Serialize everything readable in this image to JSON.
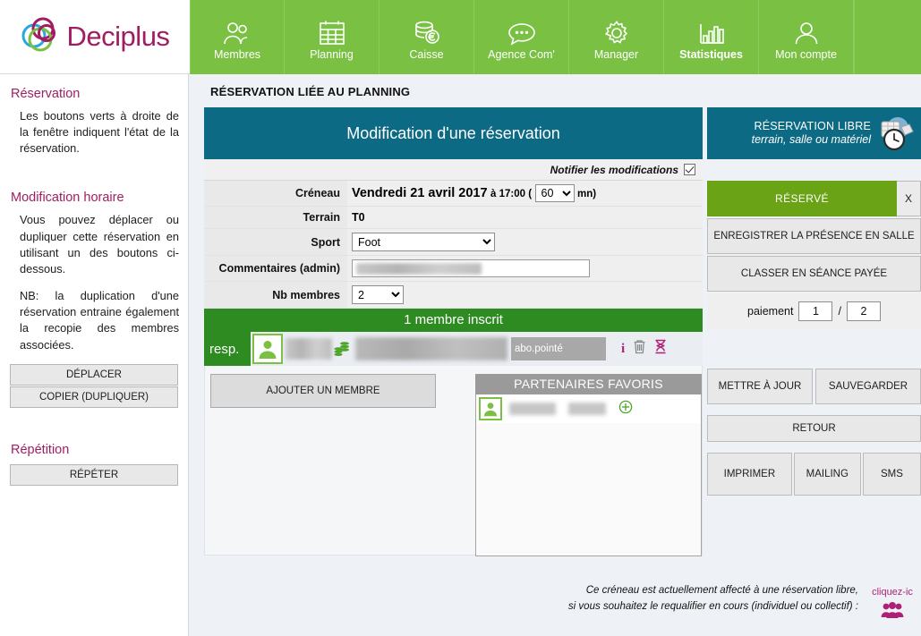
{
  "brand": {
    "name": "Deciplus",
    "logo_icon": "deciplus-rings-logo",
    "colors": {
      "magenta": "#a01d62",
      "green": "#7ac143",
      "teal": "#0d6a84",
      "blue": "#29a8df"
    }
  },
  "nav": {
    "items": [
      {
        "label": "Membres",
        "icon": "members-icon",
        "active": false
      },
      {
        "label": "Planning",
        "icon": "calendar-icon",
        "active": false
      },
      {
        "label": "Caisse",
        "icon": "cash-euro-icon",
        "active": false
      },
      {
        "label": "Agence Com'",
        "icon": "chat-bubble-icon",
        "active": false
      },
      {
        "label": "Manager",
        "icon": "gear-icon",
        "active": false
      },
      {
        "label": "Statistiques",
        "icon": "bar-chart-icon",
        "active": true
      },
      {
        "label": "Mon compte",
        "icon": "user-icon",
        "active": false
      }
    ]
  },
  "sidebar": {
    "section1_title": "Réservation",
    "section1_text": "Les boutons verts à droite de la fenêtre indiquent l'état de la réservation.",
    "section2_title": "Modification horaire",
    "section2_text": "Vous pouvez déplacer ou dupliquer cette réservation en utilisant un des boutons ci-dessous.",
    "section2_note": "NB: la duplication d'une réservation entraine également la recopie des membres associées.",
    "btn_deplacer": "DÉPLACER",
    "btn_copier": "COPIER (DUPLIQUER)",
    "section3_title": "Répétition",
    "btn_repeter": "RÉPÉTER"
  },
  "main": {
    "page_title": "RÉSERVATION LIÉE AU PLANNING",
    "panel_title": "Modification d'une réservation",
    "free_res": {
      "line1": "RÉSERVATION LIBRE",
      "line2": "terrain, salle ou matériel",
      "icon": "calendar-clock-icon"
    },
    "notify_label": "Notifier les modifications",
    "notify_checked": true,
    "form": {
      "creneau_label": "Créneau",
      "creneau_date": "Vendredi 21 avril 2017",
      "creneau_at": "à 17:00 (",
      "creneau_duration": "60",
      "creneau_unit": "mn)",
      "terrain_label": "Terrain",
      "terrain_value": "T0",
      "sport_label": "Sport",
      "sport_value": "Foot",
      "comments_label": "Commentaires (admin)",
      "comments_value": "",
      "nb_label": "Nb membres",
      "nb_value": "2"
    },
    "members": {
      "header": "1 membre inscrit",
      "resp_label": "resp.",
      "row": {
        "avatar_icon": "person-avatar-icon",
        "name": "",
        "coins_icon": "coins-icon",
        "status": "abo.pointé",
        "info_icon": "info-icon",
        "delete_icon": "trash-icon",
        "pending_icon": "hourglass-icon"
      },
      "add_button": "AJOUTER UN MEMBRE"
    },
    "favorites": {
      "title": "PARTENAIRES FAVORIS",
      "rows": [
        {
          "avatar_icon": "person-avatar-icon",
          "first_name": "",
          "last_name": "",
          "add_icon": "plus-circle-icon"
        }
      ]
    },
    "footer_note_line1": "Ce créneau est actuellement affecté à une réservation libre,",
    "footer_note_line2": "si vous souhaitez le requalifier en cours (individuel ou collectif) :",
    "footer_click_label": "cliquez-ic",
    "footer_icon": "group-people-icon"
  },
  "right_panel": {
    "status_label": "RÉSERVÉ",
    "status_close": "X",
    "btn_presence": "ENREGISTRER LA PRÉSENCE EN SALLE",
    "btn_seance": "CLASSER EN SÉANCE PAYÉE",
    "paiement_label": "paiement",
    "paiement_current": "1",
    "paiement_separator": "/",
    "paiement_total": "2",
    "btn_update": "METTRE À JOUR",
    "btn_save": "SAUVEGARDER",
    "btn_back": "RETOUR",
    "btn_print": "IMPRIMER",
    "btn_mailing": "MAILING",
    "btn_sms": "SMS"
  }
}
